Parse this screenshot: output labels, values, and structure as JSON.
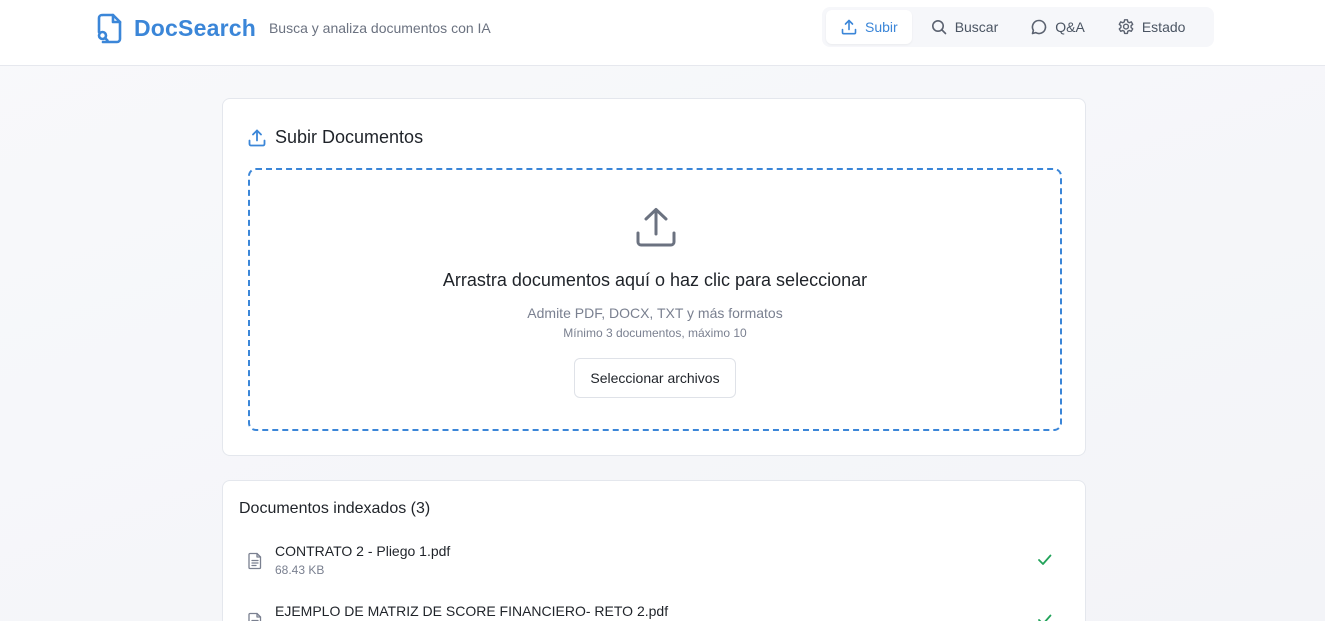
{
  "header": {
    "brand": "DocSearch",
    "tagline": "Busca y analiza documentos con IA",
    "brand_color": "#3b86d8",
    "nav": [
      {
        "label": "Subir",
        "icon": "upload-icon",
        "active": true
      },
      {
        "label": "Buscar",
        "icon": "search-icon",
        "active": false
      },
      {
        "label": "Q&A",
        "icon": "chat-bubble-icon",
        "active": false
      },
      {
        "label": "Estado",
        "icon": "gear-icon",
        "active": false
      }
    ]
  },
  "upload": {
    "title": "Subir Documentos",
    "dropzone_title": "Arrastra documentos aquí o haz clic para seleccionar",
    "dropzone_sub": "Admite PDF, DOCX, TXT y más formatos",
    "dropzone_hint": "Mínimo 3 documentos, máximo 10",
    "button_label": "Seleccionar archivos"
  },
  "indexed": {
    "title": "Documentos indexados (3)",
    "documents": [
      {
        "name": "CONTRATO 2 - Pliego 1.pdf",
        "size": "68.43 KB",
        "status": "indexed"
      },
      {
        "name": "EJEMPLO DE MATRIZ DE SCORE FINANCIERO- RETO 2.pdf",
        "size": "",
        "status": "indexed"
      }
    ]
  },
  "colors": {
    "accent": "#3b86d8",
    "success": "#22a35a"
  }
}
